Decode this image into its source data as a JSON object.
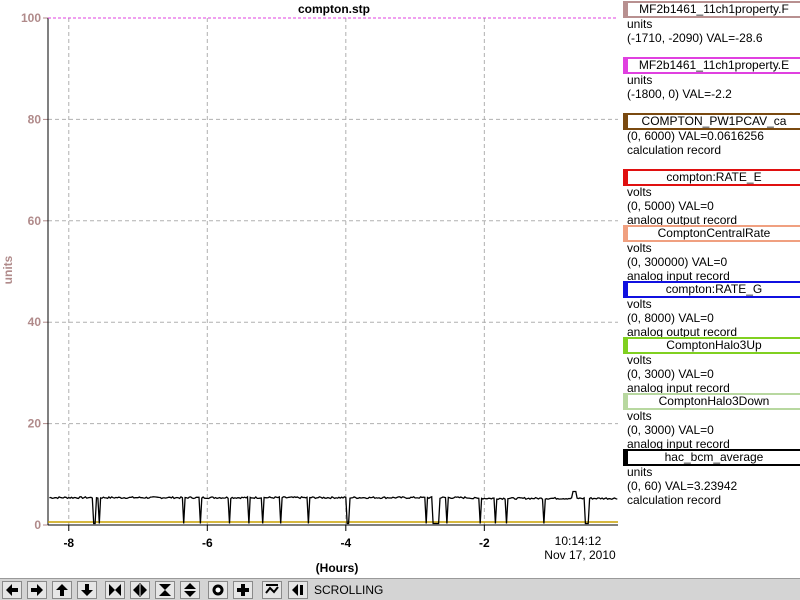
{
  "chart_data": {
    "type": "line",
    "title": "compton.stp",
    "xlabel": "(Hours)",
    "ylabel": "units",
    "xlim": [
      -8.3,
      -0.07
    ],
    "ylim": [
      0,
      100
    ],
    "x_ticks": [
      -8,
      -6,
      -4,
      -2
    ],
    "x_tick_labels": [
      "-8",
      "-6",
      "-4",
      "-2"
    ],
    "y_ticks": [
      0,
      20,
      40,
      60,
      80,
      100
    ],
    "y_tick_labels": [
      "0",
      "20",
      "40",
      "60",
      "80",
      "100"
    ],
    "grid": true,
    "time_label": "10:14:12",
    "date_label": "Nov 17, 2010",
    "series": [
      {
        "name": "hac_bcm_average",
        "color": "#000000",
        "baseline": 5.4,
        "dropouts": [
          [
            -7.65,
            -7.62
          ],
          [
            -7.58,
            -7.55
          ],
          [
            -6.35,
            -6.33
          ],
          [
            -6.12,
            -6.1
          ],
          [
            -5.7,
            -5.68
          ],
          [
            -5.42,
            -5.4
          ],
          [
            -5.22,
            -5.2
          ],
          [
            -4.95,
            -4.93
          ],
          [
            -4.55,
            -4.53
          ],
          [
            -4.0,
            -3.95
          ],
          [
            -2.85,
            -2.83
          ],
          [
            -2.75,
            -2.65
          ],
          [
            -2.55,
            -2.53
          ],
          [
            -2.08,
            -2.06
          ],
          [
            -1.85,
            -1.83
          ],
          [
            -1.7,
            -1.68
          ],
          [
            -1.15,
            -1.13
          ],
          [
            -0.55,
            -0.5
          ]
        ],
        "spike": [
          -0.7,
          6.6
        ]
      },
      {
        "name": "ComptonCentralRate",
        "color": "#c8a000",
        "value": 0.6
      },
      {
        "name": "MF2b1461_11ch1property.E",
        "color": "#e040e0",
        "value": 100
      }
    ]
  },
  "legend": [
    {
      "name": "MF2b1461_11ch1property.F",
      "color": "#b89090",
      "units": "units",
      "range": "(-1710, -2090) VAL=-28.6",
      "type": ""
    },
    {
      "name": "MF2b1461_11ch1property.E",
      "color": "#e040e0",
      "units": "units",
      "range": "(-1800, 0) VAL=-2.2",
      "type": ""
    },
    {
      "name": "COMPTON_PW1PCAV_ca",
      "color": "#7a4a10",
      "units": "",
      "range": "(0, 6000) VAL=0.0616256",
      "type": "calculation record"
    },
    {
      "name": "compton:RATE_E",
      "color": "#e01010",
      "units": "volts",
      "range": "(0, 5000) VAL=0",
      "type": "analog output record"
    },
    {
      "name": "ComptonCentralRate",
      "color": "#f0a080",
      "units": "volts",
      "range": "(0, 300000) VAL=0",
      "type": "analog input record"
    },
    {
      "name": "compton:RATE_G",
      "color": "#1010e0",
      "units": "volts",
      "range": "(0, 8000) VAL=0",
      "type": "analog output record"
    },
    {
      "name": "ComptonHalo3Up",
      "color": "#80d020",
      "units": "volts",
      "range": "(0, 3000) VAL=0",
      "type": "analog input record"
    },
    {
      "name": "ComptonHalo3Down",
      "color": "#b8d8a0",
      "units": "volts",
      "range": "(0, 3000) VAL=0",
      "type": "analog input record"
    },
    {
      "name": "hac_bcm_average",
      "color": "#000000",
      "units": "units",
      "range": "(0, 60) VAL=3.23942",
      "type": "calculation record"
    }
  ],
  "toolbar": {
    "status": "SCROLLING",
    "buttons": [
      {
        "name": "pan-left-button",
        "icon": "arrow-left-icon"
      },
      {
        "name": "pan-right-button",
        "icon": "arrow-right-icon"
      },
      {
        "name": "pan-up-button",
        "icon": "arrow-up-icon"
      },
      {
        "name": "pan-down-button",
        "icon": "arrow-down-icon"
      },
      {
        "name": "zoom-in-x-button",
        "icon": "zoom-in-x-icon"
      },
      {
        "name": "zoom-out-x-button",
        "icon": "zoom-out-x-icon"
      },
      {
        "name": "zoom-in-y-button",
        "icon": "zoom-in-y-icon"
      },
      {
        "name": "zoom-out-y-button",
        "icon": "zoom-out-y-icon"
      },
      {
        "name": "zoom-box-button",
        "icon": "circle-target-icon"
      },
      {
        "name": "zoom-reset-button",
        "icon": "plus-icon"
      },
      {
        "name": "stagger-button",
        "icon": "stagger-icon"
      },
      {
        "name": "undo-button",
        "icon": "undo-arrow-icon"
      }
    ]
  }
}
